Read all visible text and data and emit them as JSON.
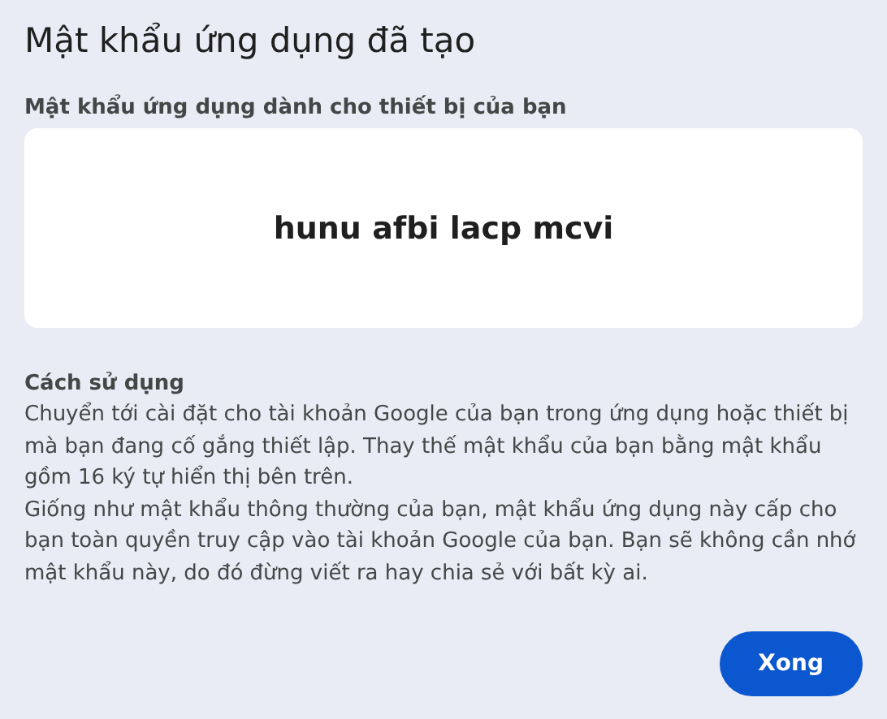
{
  "dialog": {
    "title": "Mật khẩu ứng dụng đã tạo",
    "password_label": "Mật khẩu ứng dụng dành cho thiết bị của bạn",
    "password": "hunu afbi lacp mcvi",
    "usage_heading": "Cách sử dụng",
    "usage_paragraphs": [
      "Chuyển tới cài đặt cho tài khoản Google của bạn trong ứng dụng hoặc thiết bị mà bạn đang cố gắng thiết lập. Thay thế mật khẩu của bạn bằng mật khẩu gồm 16 ký tự hiển thị bên trên.",
      "Giống như mật khẩu thông thường của bạn, mật khẩu ứng dụng này cấp cho bạn toàn quyền truy cập vào tài khoản Google của bạn. Bạn sẽ không cần nhớ mật khẩu này, do đó đừng viết ra hay chia sẻ với bất kỳ ai."
    ],
    "buttons": [
      "Xong"
    ]
  }
}
